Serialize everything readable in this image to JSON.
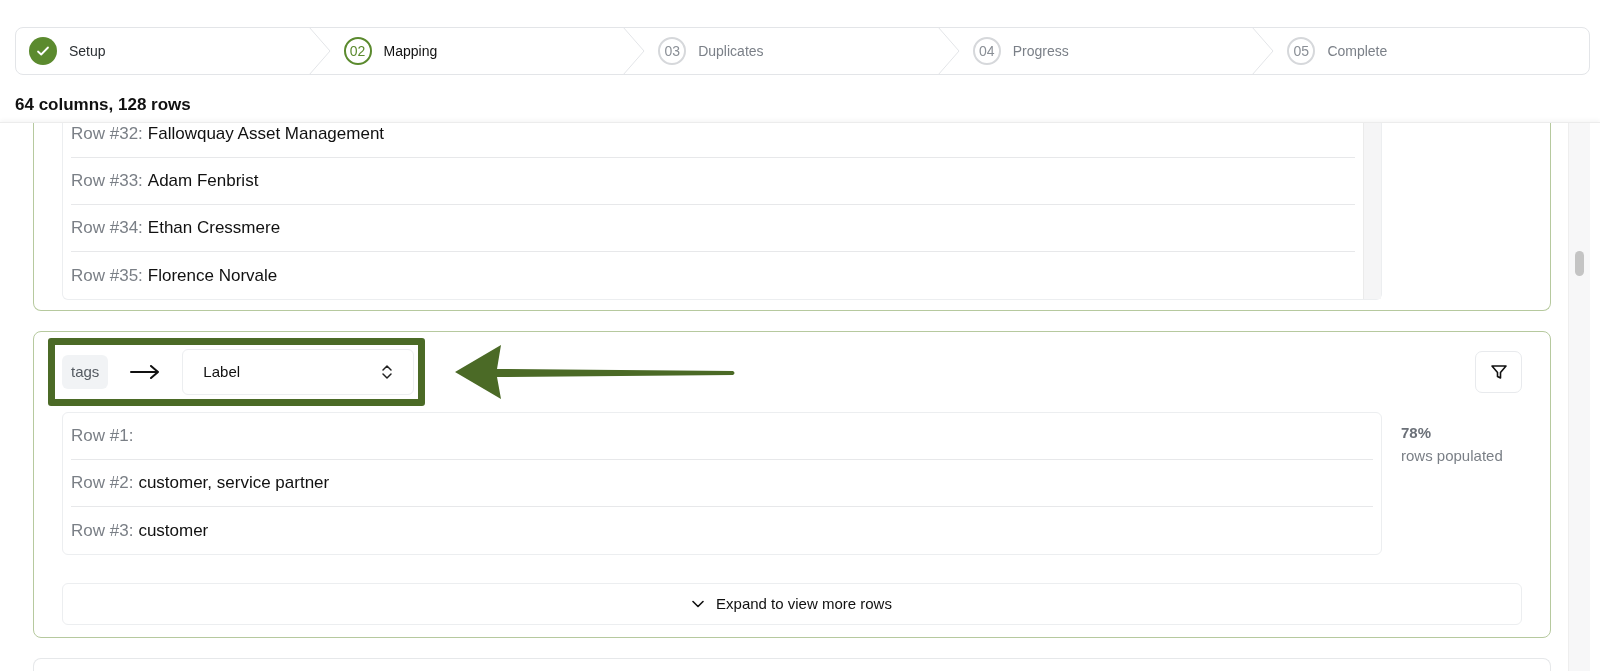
{
  "stepper": [
    {
      "label": "Setup",
      "done": true,
      "selected": false
    },
    {
      "number": "02",
      "label": "Mapping",
      "done": false,
      "selected": true
    },
    {
      "number": "03",
      "label": "Duplicates",
      "done": false,
      "selected": false
    },
    {
      "number": "04",
      "label": "Progress",
      "done": false,
      "selected": false
    },
    {
      "number": "05",
      "label": "Complete",
      "done": false,
      "selected": false
    }
  ],
  "summary": "64 columns, 128 rows",
  "columns": [
    {
      "list_scrollbar": true,
      "rows": [
        {
          "label": "Row #32:",
          "value": "Fallowquay Asset Management"
        },
        {
          "label": "Row #33:",
          "value": "Adam Fenbrist"
        },
        {
          "label": "Row #34:",
          "value": "Ethan Cressmere"
        },
        {
          "label": "Row #35:",
          "value": "Florence Norvale"
        }
      ]
    },
    {
      "source": "tags",
      "target": "Label",
      "highlighted": true,
      "stat": "78%",
      "stat_label": "rows populated",
      "expand": "Expand to view more rows",
      "rows": [
        {
          "label": "Row #1:",
          "value": ""
        },
        {
          "label": "Row #2:",
          "value": "customer, service partner"
        },
        {
          "label": "Row #3:",
          "value": "customer"
        }
      ]
    }
  ]
}
